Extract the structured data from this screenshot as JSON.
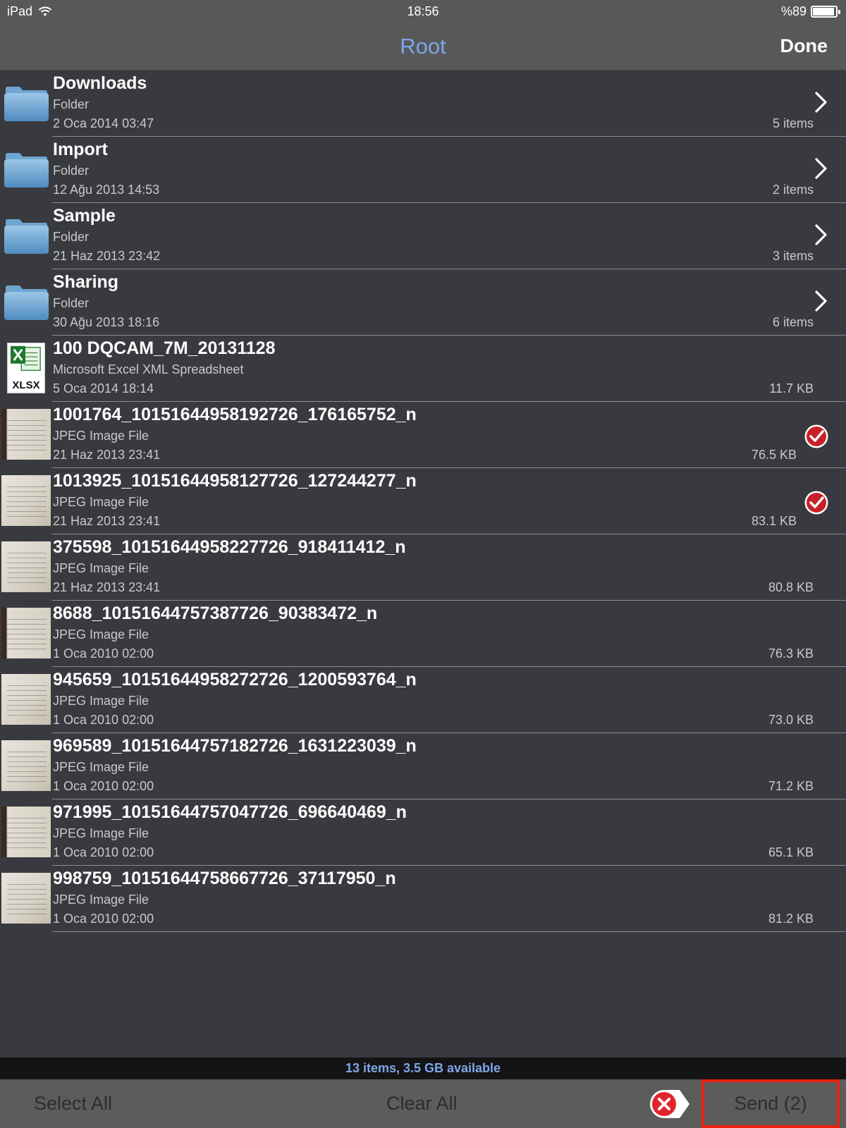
{
  "status_bar": {
    "device": "iPad",
    "time": "18:56",
    "battery_text": "%89",
    "battery_level": 0.89
  },
  "nav": {
    "title": "Root",
    "done_label": "Done"
  },
  "files": [
    {
      "name": "Downloads",
      "kind": "Folder",
      "date": "2 Oca 2014 03:47",
      "meta": "5 items",
      "type": "folder",
      "selected": false
    },
    {
      "name": "Import",
      "kind": "Folder",
      "date": "12 Ağu 2013 14:53",
      "meta": "2 items",
      "type": "folder",
      "selected": false
    },
    {
      "name": "Sample",
      "kind": "Folder",
      "date": "21 Haz 2013 23:42",
      "meta": "3 items",
      "type": "folder",
      "selected": false
    },
    {
      "name": "Sharing",
      "kind": "Folder",
      "date": "30 Ağu 2013 18:16",
      "meta": "6 items",
      "type": "folder",
      "selected": false
    },
    {
      "name": "100 DQCAM_7M_20131128",
      "kind": "Microsoft Excel XML Spreadsheet",
      "date": "5 Oca 2014 18:14",
      "meta": "11.7 KB",
      "type": "xlsx",
      "icon_text": "XLSX",
      "selected": false
    },
    {
      "name": "1001764_10151644958192726_176165752_n",
      "kind": "JPEG Image File",
      "date": "21 Haz 2013 23:41",
      "meta": "76.5 KB",
      "type": "jpeg",
      "selected": true
    },
    {
      "name": "1013925_10151644958127726_127244277_n",
      "kind": "JPEG Image File",
      "date": "21 Haz 2013 23:41",
      "meta": "83.1 KB",
      "type": "jpeg",
      "selected": true
    },
    {
      "name": "375598_10151644958227726_918411412_n",
      "kind": "JPEG Image File",
      "date": "21 Haz 2013 23:41",
      "meta": "80.8 KB",
      "type": "jpeg",
      "selected": false
    },
    {
      "name": "8688_10151644757387726_90383472_n",
      "kind": "JPEG Image File",
      "date": "1 Oca 2010 02:00",
      "meta": "76.3 KB",
      "type": "jpeg",
      "selected": false
    },
    {
      "name": "945659_10151644958272726_1200593764_n",
      "kind": "JPEG Image File",
      "date": "1 Oca 2010 02:00",
      "meta": "73.0 KB",
      "type": "jpeg",
      "selected": false
    },
    {
      "name": "969589_10151644757182726_1631223039_n",
      "kind": "JPEG Image File",
      "date": "1 Oca 2010 02:00",
      "meta": "71.2 KB",
      "type": "jpeg",
      "selected": false
    },
    {
      "name": "971995_10151644757047726_696640469_n",
      "kind": "JPEG Image File",
      "date": "1 Oca 2010 02:00",
      "meta": "65.1 KB",
      "type": "jpeg",
      "selected": false
    },
    {
      "name": "998759_10151644758667726_37117950_n",
      "kind": "JPEG Image File",
      "date": "1 Oca 2010 02:00",
      "meta": "81.2 KB",
      "type": "jpeg",
      "selected": false
    }
  ],
  "footer": {
    "summary": "13 items, 3.5 GB available"
  },
  "toolbar": {
    "select_all_label": "Select All",
    "clear_all_label": "Clear All",
    "send_label": "Send (2)"
  },
  "colors": {
    "accent": "#7ea6e8",
    "background": "#393a3f",
    "bar": "#585858",
    "highlight_box": "#e8210e",
    "check_red": "#c8202a"
  }
}
